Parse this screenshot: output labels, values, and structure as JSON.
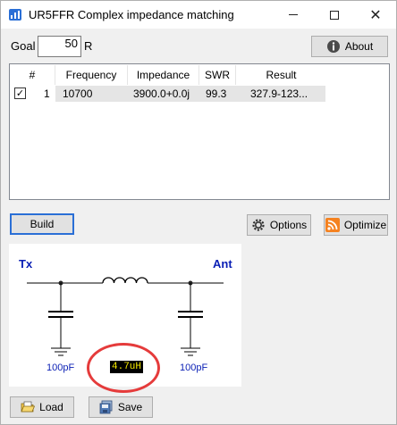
{
  "window": {
    "title": "UR5FFR Complex impedance matching",
    "close_symbol": "✕"
  },
  "goal": {
    "label": "Goal",
    "value": "50",
    "unit": "R"
  },
  "buttons": {
    "about": "About",
    "build": "Build",
    "options": "Options",
    "optimize": "Optimize",
    "load": "Load",
    "save": "Save"
  },
  "table": {
    "columns": [
      "#",
      "Frequency",
      "Impedance",
      "SWR",
      "Result"
    ],
    "rows": [
      {
        "checked": true,
        "check_mark": "✓",
        "num": "1",
        "frequency": "10700",
        "impedance": "3900.0+0.0j",
        "swr": "99.3",
        "result": "327.9-123..."
      }
    ]
  },
  "circuit": {
    "left_label": "Tx",
    "right_label": "Ant",
    "cap_left": "100pF",
    "cap_right": "100pF",
    "inductor": "4.7uH"
  },
  "colors": {
    "accent_blue": "#0a1fb5",
    "highlight_ring": "#e53b3b",
    "inductor_label_bg": "#000000",
    "inductor_label_fg": "#f5e800"
  },
  "icons": {
    "app": "app-icon",
    "about": "info-icon",
    "options": "gear-icon",
    "optimize": "rss-feed-icon",
    "load": "folder-open-icon",
    "save": "save-disk-icon"
  }
}
